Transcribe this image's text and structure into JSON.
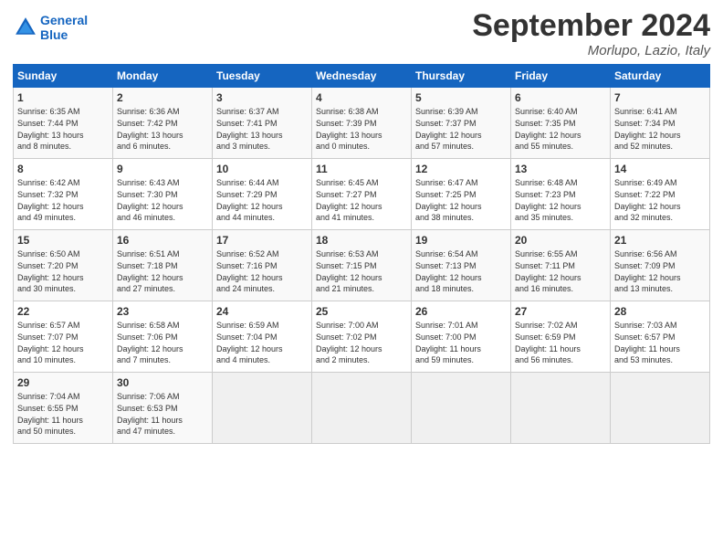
{
  "header": {
    "logo_line1": "General",
    "logo_line2": "Blue",
    "month_year": "September 2024",
    "location": "Morlupo, Lazio, Italy"
  },
  "weekdays": [
    "Sunday",
    "Monday",
    "Tuesday",
    "Wednesday",
    "Thursday",
    "Friday",
    "Saturday"
  ],
  "weeks": [
    [
      {
        "day": "1",
        "info": "Sunrise: 6:35 AM\nSunset: 7:44 PM\nDaylight: 13 hours\nand 8 minutes."
      },
      {
        "day": "2",
        "info": "Sunrise: 6:36 AM\nSunset: 7:42 PM\nDaylight: 13 hours\nand 6 minutes."
      },
      {
        "day": "3",
        "info": "Sunrise: 6:37 AM\nSunset: 7:41 PM\nDaylight: 13 hours\nand 3 minutes."
      },
      {
        "day": "4",
        "info": "Sunrise: 6:38 AM\nSunset: 7:39 PM\nDaylight: 13 hours\nand 0 minutes."
      },
      {
        "day": "5",
        "info": "Sunrise: 6:39 AM\nSunset: 7:37 PM\nDaylight: 12 hours\nand 57 minutes."
      },
      {
        "day": "6",
        "info": "Sunrise: 6:40 AM\nSunset: 7:35 PM\nDaylight: 12 hours\nand 55 minutes."
      },
      {
        "day": "7",
        "info": "Sunrise: 6:41 AM\nSunset: 7:34 PM\nDaylight: 12 hours\nand 52 minutes."
      }
    ],
    [
      {
        "day": "8",
        "info": "Sunrise: 6:42 AM\nSunset: 7:32 PM\nDaylight: 12 hours\nand 49 minutes."
      },
      {
        "day": "9",
        "info": "Sunrise: 6:43 AM\nSunset: 7:30 PM\nDaylight: 12 hours\nand 46 minutes."
      },
      {
        "day": "10",
        "info": "Sunrise: 6:44 AM\nSunset: 7:29 PM\nDaylight: 12 hours\nand 44 minutes."
      },
      {
        "day": "11",
        "info": "Sunrise: 6:45 AM\nSunset: 7:27 PM\nDaylight: 12 hours\nand 41 minutes."
      },
      {
        "day": "12",
        "info": "Sunrise: 6:47 AM\nSunset: 7:25 PM\nDaylight: 12 hours\nand 38 minutes."
      },
      {
        "day": "13",
        "info": "Sunrise: 6:48 AM\nSunset: 7:23 PM\nDaylight: 12 hours\nand 35 minutes."
      },
      {
        "day": "14",
        "info": "Sunrise: 6:49 AM\nSunset: 7:22 PM\nDaylight: 12 hours\nand 32 minutes."
      }
    ],
    [
      {
        "day": "15",
        "info": "Sunrise: 6:50 AM\nSunset: 7:20 PM\nDaylight: 12 hours\nand 30 minutes."
      },
      {
        "day": "16",
        "info": "Sunrise: 6:51 AM\nSunset: 7:18 PM\nDaylight: 12 hours\nand 27 minutes."
      },
      {
        "day": "17",
        "info": "Sunrise: 6:52 AM\nSunset: 7:16 PM\nDaylight: 12 hours\nand 24 minutes."
      },
      {
        "day": "18",
        "info": "Sunrise: 6:53 AM\nSunset: 7:15 PM\nDaylight: 12 hours\nand 21 minutes."
      },
      {
        "day": "19",
        "info": "Sunrise: 6:54 AM\nSunset: 7:13 PM\nDaylight: 12 hours\nand 18 minutes."
      },
      {
        "day": "20",
        "info": "Sunrise: 6:55 AM\nSunset: 7:11 PM\nDaylight: 12 hours\nand 16 minutes."
      },
      {
        "day": "21",
        "info": "Sunrise: 6:56 AM\nSunset: 7:09 PM\nDaylight: 12 hours\nand 13 minutes."
      }
    ],
    [
      {
        "day": "22",
        "info": "Sunrise: 6:57 AM\nSunset: 7:07 PM\nDaylight: 12 hours\nand 10 minutes."
      },
      {
        "day": "23",
        "info": "Sunrise: 6:58 AM\nSunset: 7:06 PM\nDaylight: 12 hours\nand 7 minutes."
      },
      {
        "day": "24",
        "info": "Sunrise: 6:59 AM\nSunset: 7:04 PM\nDaylight: 12 hours\nand 4 minutes."
      },
      {
        "day": "25",
        "info": "Sunrise: 7:00 AM\nSunset: 7:02 PM\nDaylight: 12 hours\nand 2 minutes."
      },
      {
        "day": "26",
        "info": "Sunrise: 7:01 AM\nSunset: 7:00 PM\nDaylight: 11 hours\nand 59 minutes."
      },
      {
        "day": "27",
        "info": "Sunrise: 7:02 AM\nSunset: 6:59 PM\nDaylight: 11 hours\nand 56 minutes."
      },
      {
        "day": "28",
        "info": "Sunrise: 7:03 AM\nSunset: 6:57 PM\nDaylight: 11 hours\nand 53 minutes."
      }
    ],
    [
      {
        "day": "29",
        "info": "Sunrise: 7:04 AM\nSunset: 6:55 PM\nDaylight: 11 hours\nand 50 minutes."
      },
      {
        "day": "30",
        "info": "Sunrise: 7:06 AM\nSunset: 6:53 PM\nDaylight: 11 hours\nand 47 minutes."
      },
      {
        "day": "",
        "info": ""
      },
      {
        "day": "",
        "info": ""
      },
      {
        "day": "",
        "info": ""
      },
      {
        "day": "",
        "info": ""
      },
      {
        "day": "",
        "info": ""
      }
    ]
  ]
}
